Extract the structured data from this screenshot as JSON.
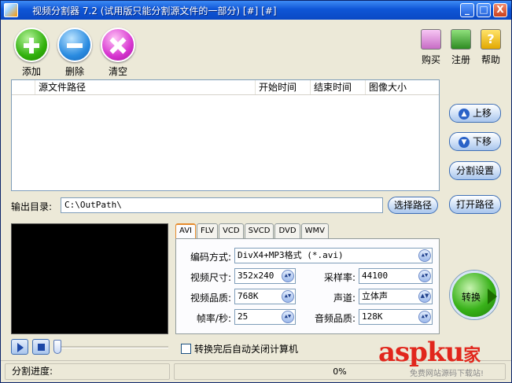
{
  "window": {
    "title": "视频分割器 7.2 (试用版只能分割源文件的一部分) [#] [#]",
    "minimize_glyph": "_",
    "maximize_glyph": "□",
    "close_glyph": "X"
  },
  "toolbar": {
    "add": "添加",
    "delete": "删除",
    "clear": "清空",
    "buy": "购买",
    "register": "注册",
    "help": "帮助",
    "help_glyph": "?"
  },
  "file_list": {
    "columns": [
      "源文件路径",
      "开始时间",
      "结束时间",
      "图像大小"
    ],
    "rows": []
  },
  "side_buttons": {
    "move_up": "上移",
    "move_down": "下移",
    "split_settings": "分割设置",
    "open_path": "打开路径",
    "up_glyph": "▲",
    "down_glyph": "▼"
  },
  "output": {
    "label": "输出目录:",
    "path": "C:\\OutPath\\",
    "choose_button": "选择路径"
  },
  "format_tabs": [
    "AVI",
    "FLV",
    "VCD",
    "SVCD",
    "DVD",
    "WMV"
  ],
  "settings": {
    "encoding_label": "编码方式:",
    "encoding_value": "DivX4+MP3格式 (*.avi)",
    "video_size_label": "视频尺寸:",
    "video_size_value": "352x240",
    "sample_rate_label": "采样率:",
    "sample_rate_value": "44100",
    "video_quality_label": "视频品质:",
    "video_quality_value": "768K",
    "channel_label": "声道:",
    "channel_value": "立体声",
    "framerate_label": "帧率/秒:",
    "framerate_value": "25",
    "audio_quality_label": "音频品质:",
    "audio_quality_value": "128K",
    "combo_glyph": "▲▼"
  },
  "convert_button": "转换",
  "player": {
    "seek_position": 0
  },
  "auto_shutdown_label": "转换完后自动关闭计算机",
  "status": {
    "label": "分割进度:",
    "progress": "0%"
  },
  "watermark": {
    "brand": "aspku",
    "brand_cn": "家",
    "sub": "免费网站源码下载站!"
  },
  "colors": {
    "title_bar": "#0f56d6",
    "window_bg": "#ece9d8",
    "watermark": "#e1261c"
  }
}
